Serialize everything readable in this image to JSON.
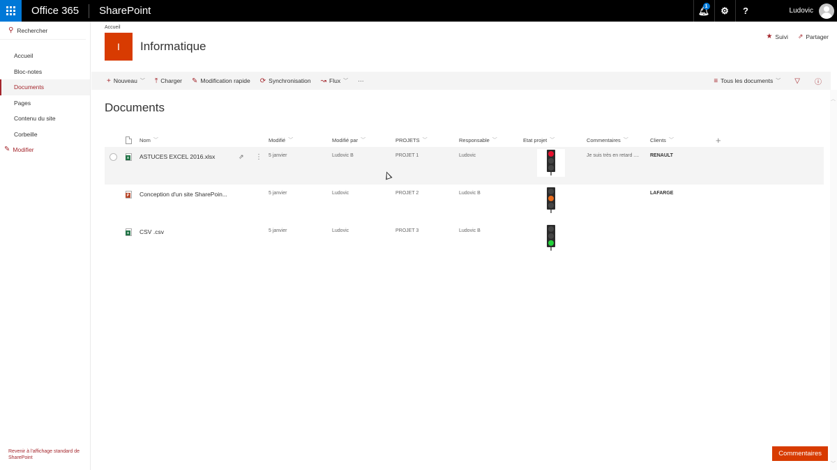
{
  "suitebar": {
    "brand": "Office 365",
    "app": "SharePoint",
    "notification_count": "1",
    "user_name": "Ludovic"
  },
  "leftnav": {
    "search_label": "Rechercher",
    "items": [
      {
        "label": "Accueil",
        "active": false
      },
      {
        "label": "Bloc-notes",
        "active": false
      },
      {
        "label": "Documents",
        "active": true
      },
      {
        "label": "Pages",
        "active": false
      },
      {
        "label": "Contenu du site",
        "active": false
      },
      {
        "label": "Corbeille",
        "active": false
      }
    ],
    "edit_label": "Modifier",
    "back_to_standard": "Revenir à l'affichage standard de SharePoint"
  },
  "header": {
    "breadcrumb": "Accueil",
    "logo_letter": "I",
    "site_title": "Informatique",
    "follow_label": "Suivi",
    "share_label": "Partager"
  },
  "commandbar": {
    "new_label": "Nouveau",
    "upload_label": "Charger",
    "quick_edit_label": "Modification rapide",
    "sync_label": "Synchronisation",
    "flow_label": "Flux",
    "more_label": "···",
    "view_label": "Tous les documents"
  },
  "library": {
    "title": "Documents",
    "columns": {
      "name": "Nom",
      "modified": "Modifié",
      "modified_by": "Modifié par",
      "projects": "PROJETS",
      "owner": "Responsable",
      "status": "Etat projet",
      "comments": "Commentaires",
      "clients": "Clients"
    },
    "rows": [
      {
        "type": "xlsx",
        "icon_letter": "x",
        "name": "ASTUCES EXCEL 2016.xlsx",
        "modified": "5 janvier",
        "modified_by": "Ludovic B",
        "project": "PROJET 1",
        "owner": "Ludovic",
        "status": "red",
        "comment": "Je suis très en retard ....",
        "client": "RENAULT"
      },
      {
        "type": "pptx",
        "icon_letter": "P",
        "name": "Conception d'un site SharePoin...",
        "modified": "5 janvier",
        "modified_by": "Ludovic",
        "project": "PROJET 2",
        "owner": "Ludovic B",
        "status": "orange",
        "comment": "",
        "client": "LAFARGE"
      },
      {
        "type": "csv",
        "icon_letter": "x",
        "name": "CSV .csv",
        "modified": "5 janvier",
        "modified_by": "Ludovic",
        "project": "PROJET 3",
        "owner": "Ludovic B",
        "status": "green",
        "comment": "",
        "client": ""
      }
    ]
  },
  "feedback_button": "Commentaires",
  "colors": {
    "suitebar": "#000000",
    "waffle": "#0078d7",
    "accent": "#a4262c",
    "site_logo": "#d83b01",
    "feedback_button": "#d83b01"
  }
}
